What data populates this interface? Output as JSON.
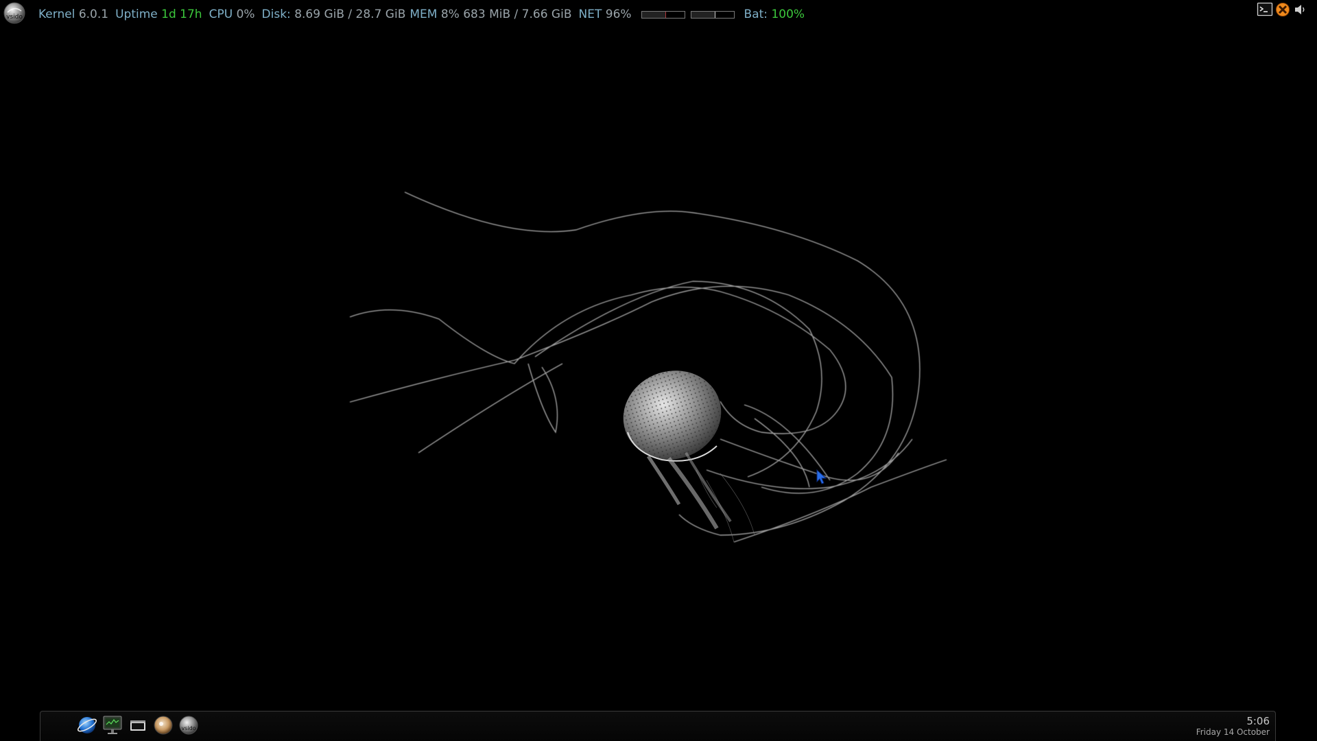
{
  "topbar": {
    "logo_icon": "vsido-logo-icon",
    "kernel_label": "Kernel",
    "kernel_value": "6.0.1",
    "uptime_label": "Uptime",
    "uptime_value": "1d 17h",
    "cpu_label": "CPU",
    "cpu_value": "0%",
    "disk_label": "Disk:",
    "disk_value": "8.69 GiB / 28.7 GiB",
    "mem_label": "MEM",
    "mem_value": "8% 683 MiB / 7.66 GiB",
    "net_label": "NET",
    "net_value": "96%",
    "meters": [
      {
        "name": "net-down-meter",
        "level": 0.56
      },
      {
        "name": "net-up-meter",
        "level": 0.56
      }
    ],
    "bat_label": "Bat:",
    "bat_value": "100%",
    "colors": {
      "label": "#7fb0c8",
      "value": "#9aa4aa",
      "good": "#3cc83c"
    }
  },
  "tray": [
    {
      "name": "terminal-icon"
    },
    {
      "name": "xfburn-icon"
    },
    {
      "name": "volume-icon"
    }
  ],
  "dock": {
    "launchers": [
      {
        "name": "browser-launcher",
        "icon": "globe-icon"
      },
      {
        "name": "system-monitor-launcher",
        "icon": "monitor-icon"
      },
      {
        "name": "terminal-launcher",
        "icon": "terminal-icon"
      },
      {
        "name": "file-manager-launcher",
        "icon": "file-manager-icon"
      },
      {
        "name": "vsido-launcher",
        "icon": "vsido-logo-icon"
      }
    ],
    "clock": {
      "time": "5:06",
      "date": "Friday 14 October"
    }
  },
  "wallpaper": {
    "subject": "jellyfish-icon"
  }
}
